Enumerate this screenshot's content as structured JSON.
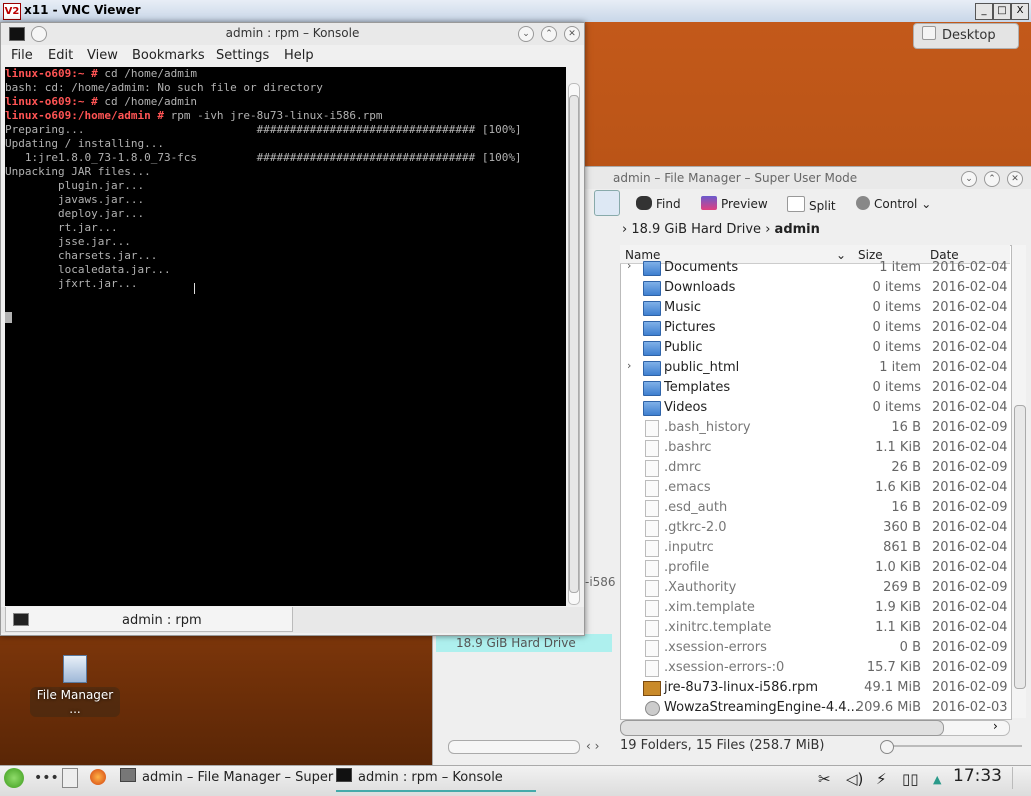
{
  "vnc": {
    "title": "x11 - VNC Viewer",
    "logo": "V2",
    "buttons": [
      "_",
      "□",
      "X"
    ]
  },
  "desktop": {
    "button_label": "Desktop",
    "icon_label": "File Manager ...",
    "background_color": "#b4520f"
  },
  "konsole": {
    "title": "admin : rpm – Konsole",
    "menu": [
      "File",
      "Edit",
      "View",
      "Bookmarks",
      "Settings",
      "Help"
    ],
    "lines": [
      {
        "prompt": "linux-o609:~ # ",
        "text": "cd /home/admim"
      },
      {
        "prompt": "",
        "text": "bash: cd: /home/admim: No such file or directory"
      },
      {
        "prompt": "linux-o609:~ # ",
        "text": "cd /home/admin"
      },
      {
        "prompt": "linux-o609:/home/admin # ",
        "text": "rpm -ivh jre-8u73-linux-i586.rpm"
      },
      {
        "prompt": "",
        "text": "Preparing...                          ################################# [100%]"
      },
      {
        "prompt": "",
        "text": "Updating / installing..."
      },
      {
        "prompt": "",
        "text": "   1:jre1.8.0_73-1.8.0_73-fcs         ################################# [100%]"
      },
      {
        "prompt": "",
        "text": "Unpacking JAR files..."
      },
      {
        "prompt": "",
        "text": "        plugin.jar..."
      },
      {
        "prompt": "",
        "text": "        javaws.jar..."
      },
      {
        "prompt": "",
        "text": "        deploy.jar..."
      },
      {
        "prompt": "",
        "text": "        rt.jar..."
      },
      {
        "prompt": "",
        "text": "        jsse.jar..."
      },
      {
        "prompt": "",
        "text": "        charsets.jar..."
      },
      {
        "prompt": "",
        "text": "        localedata.jar..."
      },
      {
        "prompt": "",
        "text": "        jfxrt.jar..."
      }
    ],
    "tab_label": "admin : rpm"
  },
  "file_manager": {
    "title": "admin – File Manager – Super User Mode",
    "toolbar": [
      "Find",
      "Preview",
      "Split",
      "Control"
    ],
    "breadcrumb": {
      "parent": "18.9 GiB Hard Drive",
      "current": "admin"
    },
    "columns": [
      "Name",
      "Size",
      "Date"
    ],
    "rows": [
      {
        "name": "Documents",
        "size": "1 item",
        "date": "2016-02-04",
        "type": "folder",
        "expandable": true
      },
      {
        "name": "Downloads",
        "size": "0 items",
        "date": "2016-02-04",
        "type": "folder"
      },
      {
        "name": "Music",
        "size": "0 items",
        "date": "2016-02-04",
        "type": "folder"
      },
      {
        "name": "Pictures",
        "size": "0 items",
        "date": "2016-02-04",
        "type": "folder"
      },
      {
        "name": "Public",
        "size": "0 items",
        "date": "2016-02-04",
        "type": "folder"
      },
      {
        "name": "public_html",
        "size": "1 item",
        "date": "2016-02-04",
        "type": "folder",
        "expandable": true
      },
      {
        "name": "Templates",
        "size": "0 items",
        "date": "2016-02-04",
        "type": "folder"
      },
      {
        "name": "Videos",
        "size": "0 items",
        "date": "2016-02-04",
        "type": "folder"
      },
      {
        "name": ".bash_history",
        "size": "16 B",
        "date": "2016-02-09",
        "type": "file"
      },
      {
        "name": ".bashrc",
        "size": "1.1 KiB",
        "date": "2016-02-04",
        "type": "file"
      },
      {
        "name": ".dmrc",
        "size": "26 B",
        "date": "2016-02-09",
        "type": "file"
      },
      {
        "name": ".emacs",
        "size": "1.6 KiB",
        "date": "2016-02-04",
        "type": "file"
      },
      {
        "name": ".esd_auth",
        "size": "16 B",
        "date": "2016-02-09",
        "type": "file"
      },
      {
        "name": ".gtkrc-2.0",
        "size": "360 B",
        "date": "2016-02-04",
        "type": "file"
      },
      {
        "name": ".inputrc",
        "size": "861 B",
        "date": "2016-02-04",
        "type": "file"
      },
      {
        "name": ".profile",
        "size": "1.0 KiB",
        "date": "2016-02-04",
        "type": "file"
      },
      {
        "name": ".Xauthority",
        "size": "269 B",
        "date": "2016-02-09",
        "type": "file"
      },
      {
        "name": ".xim.template",
        "size": "1.9 KiB",
        "date": "2016-02-04",
        "type": "file"
      },
      {
        "name": ".xinitrc.template",
        "size": "1.1 KiB",
        "date": "2016-02-04",
        "type": "file"
      },
      {
        "name": ".xsession-errors",
        "size": "0 B",
        "date": "2016-02-09",
        "type": "file"
      },
      {
        "name": ".xsession-errors-:0",
        "size": "15.7 KiB",
        "date": "2016-02-09",
        "type": "file"
      },
      {
        "name": "jre-8u73-linux-i586.rpm",
        "size": "49.1 MiB",
        "date": "2016-02-09",
        "type": "rpm"
      },
      {
        "name": "WowzaStreamingEngine-4.4...",
        "size": "209.6 MiB",
        "date": "2016-02-03",
        "type": "gear"
      }
    ],
    "places_selected": "18.9 GiB Hard Drive",
    "places_truncated": "-i586",
    "status": "19 Folders, 15 Files (258.7 MiB)"
  },
  "taskbar": {
    "tasks": [
      "admin – File Manager – Super",
      "admin : rpm – Konsole"
    ],
    "clock": "17:33",
    "tray_icons": [
      "tools-icon",
      "volume-icon",
      "network-icon",
      "battery-icon",
      "arrow-up-icon"
    ]
  }
}
